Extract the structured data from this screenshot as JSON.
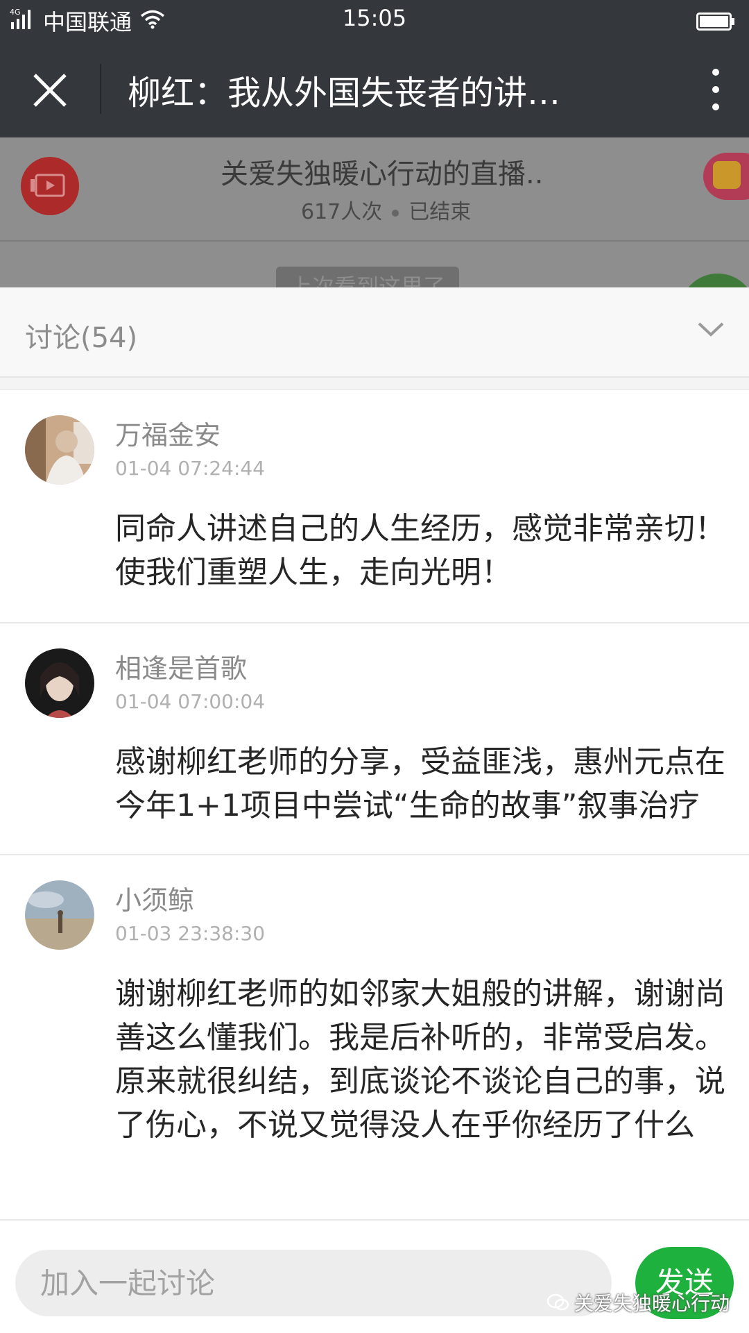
{
  "status_bar": {
    "signal": "4G",
    "carrier": "中国联通",
    "time": "15:05"
  },
  "title_bar": {
    "title": "柳红：我从外国失丧者的讲…"
  },
  "live_info": {
    "title": "关爱失独暖心行动的直播..",
    "views": "617人次",
    "status": "已结束",
    "resume_hint": "上次看到这里了"
  },
  "discussion": {
    "title": "讨论(54)"
  },
  "comments": [
    {
      "name": "万福金安",
      "time": "01-04 07:24:44",
      "text": "同命人讲述自己的人生经历，感觉非常亲切！使我们重塑人生，走向光明！"
    },
    {
      "name": "相逢是首歌",
      "time": "01-04 07:00:04",
      "text": "感谢柳红老师的分享，受益匪浅，惠州元点在今年1+1项目中尝试“生命的故事”叙事治疗"
    },
    {
      "name": "小须鲸",
      "time": "01-03 23:38:30",
      "text": "谢谢柳红老师的如邻家大姐般的讲解，谢谢尚善这么懂我们。我是后补听的，非常受启发。原来就很纠结，到底谈论不谈论自己的事，说了伤心，不说又觉得没人在乎你经历了什么"
    }
  ],
  "footer": {
    "input_placeholder": "加入一起讨论",
    "send_label": "发送"
  },
  "watermark": "关爱失独暖心行动",
  "colors": {
    "bar_bg": "#34373c",
    "send_green": "#1fb13d",
    "overlay_gray": "#8e8e8e"
  }
}
